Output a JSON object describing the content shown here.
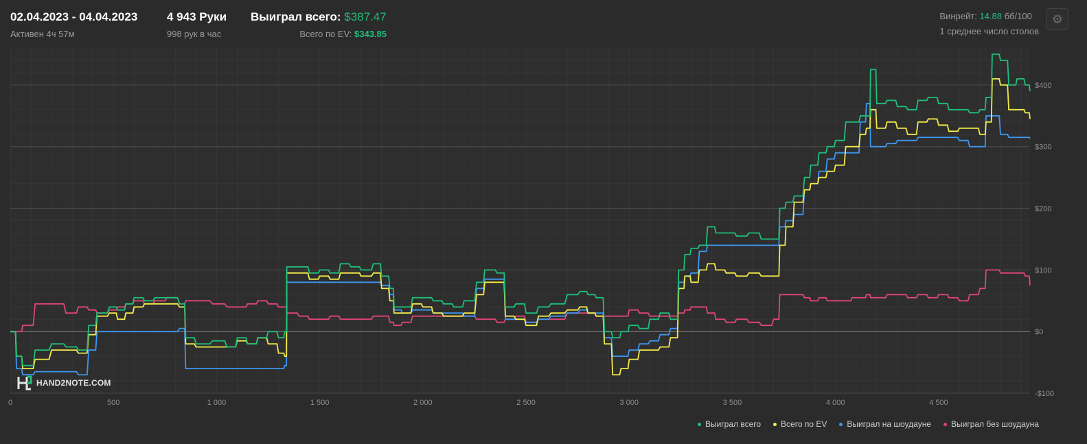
{
  "header": {
    "date_range": "02.04.2023 - 04.04.2023",
    "active": "Активен 4ч 57м",
    "hands": "4 943 Руки",
    "hands_per_hour": "998 рук в час",
    "won_label": "Выиграл всего:",
    "won_value": "$387.47",
    "ev_label": "Всего по EV:",
    "ev_value": "$343.85",
    "winrate_label": "Винрейт:",
    "winrate_value": "14.88",
    "winrate_unit": "бб/100",
    "avg_tables": "1 среднее число столов"
  },
  "logo": {
    "text": "HAND2NOTE.COM"
  },
  "colors": {
    "won_total": "#1fbf7a",
    "ev": "#f2ea4a",
    "showdown": "#3d97f0",
    "non_showdown": "#e0457a",
    "background": "#2b2b2b",
    "plot_bg": "#2e2e2e"
  },
  "chart_data": {
    "type": "line",
    "xlabel": "",
    "ylabel": "",
    "xlim": [
      0,
      4943
    ],
    "ylim": [
      -100,
      460
    ],
    "x_ticks": [
      0,
      500,
      1000,
      1500,
      2000,
      2500,
      3000,
      3500,
      4000,
      4500
    ],
    "x_tick_labels": [
      "0",
      "500",
      "1 000",
      "1 500",
      "2 000",
      "2 500",
      "3 000",
      "3 500",
      "4 000",
      "4 500"
    ],
    "y_ticks": [
      -100,
      0,
      100,
      200,
      300,
      400
    ],
    "y_tick_labels": [
      "-$100",
      "$0",
      "$100",
      "$200",
      "$300",
      "$400"
    ],
    "grid": true,
    "legend_position": "bottom-right",
    "series": [
      {
        "name": "Выиграл всего",
        "color": "#1fbf7a",
        "x": [
          0,
          30,
          60,
          120,
          200,
          270,
          330,
          380,
          420,
          480,
          520,
          560,
          600,
          650,
          700,
          760,
          820,
          850,
          900,
          980,
          1050,
          1100,
          1150,
          1200,
          1250,
          1300,
          1330,
          1340,
          1400,
          1450,
          1500,
          1550,
          1600,
          1650,
          1700,
          1760,
          1800,
          1840,
          1860,
          1900,
          1950,
          2000,
          2050,
          2100,
          2150,
          2200,
          2260,
          2300,
          2360,
          2400,
          2450,
          2500,
          2560,
          2620,
          2700,
          2760,
          2800,
          2840,
          2880,
          2920,
          2960,
          3000,
          3050,
          3100,
          3150,
          3200,
          3240,
          3270,
          3300,
          3340,
          3380,
          3420,
          3470,
          3520,
          3580,
          3640,
          3700,
          3730,
          3760,
          3800,
          3850,
          3880,
          3920,
          3960,
          4000,
          4050,
          4080,
          4120,
          4150,
          4170,
          4200,
          4250,
          4300,
          4350,
          4400,
          4450,
          4500,
          4550,
          4600,
          4650,
          4700,
          4730,
          4760,
          4800,
          4840,
          4880,
          4920,
          4943
        ],
        "y": [
          0,
          -40,
          -55,
          -30,
          -20,
          -25,
          -30,
          10,
          30,
          40,
          35,
          45,
          55,
          50,
          55,
          55,
          45,
          -10,
          -20,
          -15,
          -25,
          -10,
          -20,
          -10,
          0,
          -10,
          0,
          105,
          105,
          95,
          100,
          95,
          110,
          105,
          100,
          110,
          90,
          70,
          40,
          40,
          55,
          55,
          50,
          45,
          40,
          50,
          80,
          100,
          95,
          40,
          45,
          30,
          40,
          45,
          60,
          65,
          60,
          55,
          0,
          -10,
          0,
          10,
          5,
          20,
          30,
          20,
          100,
          125,
          135,
          140,
          170,
          160,
          160,
          155,
          160,
          150,
          150,
          200,
          210,
          220,
          250,
          270,
          290,
          300,
          310,
          340,
          340,
          350,
          350,
          425,
          370,
          375,
          365,
          360,
          375,
          380,
          370,
          360,
          360,
          355,
          360,
          380,
          450,
          440,
          400,
          410,
          400,
          390
        ]
      },
      {
        "name": "Всего по EV",
        "color": "#f2ea4a",
        "x": [
          0,
          30,
          60,
          120,
          200,
          270,
          330,
          380,
          420,
          480,
          520,
          560,
          600,
          650,
          700,
          760,
          820,
          850,
          900,
          980,
          1050,
          1100,
          1150,
          1200,
          1250,
          1300,
          1330,
          1340,
          1400,
          1450,
          1500,
          1550,
          1600,
          1650,
          1700,
          1760,
          1800,
          1840,
          1860,
          1900,
          1950,
          2000,
          2050,
          2100,
          2150,
          2200,
          2260,
          2300,
          2360,
          2400,
          2450,
          2500,
          2560,
          2620,
          2700,
          2760,
          2800,
          2840,
          2880,
          2920,
          2960,
          3000,
          3050,
          3100,
          3150,
          3200,
          3240,
          3270,
          3300,
          3340,
          3380,
          3420,
          3470,
          3520,
          3580,
          3640,
          3700,
          3730,
          3760,
          3800,
          3850,
          3880,
          3920,
          3960,
          4000,
          4050,
          4080,
          4120,
          4150,
          4170,
          4200,
          4250,
          4300,
          4350,
          4400,
          4450,
          4500,
          4550,
          4600,
          4650,
          4700,
          4730,
          4760,
          4800,
          4840,
          4880,
          4920,
          4943
        ],
        "y": [
          0,
          -40,
          -60,
          -45,
          -30,
          -30,
          -35,
          -5,
          25,
          30,
          20,
          30,
          40,
          45,
          45,
          45,
          40,
          -20,
          -25,
          -25,
          -25,
          -15,
          -20,
          -10,
          -20,
          -35,
          -40,
          95,
          95,
          85,
          90,
          85,
          95,
          95,
          90,
          95,
          70,
          50,
          30,
          30,
          45,
          40,
          30,
          25,
          25,
          30,
          60,
          80,
          80,
          25,
          20,
          10,
          25,
          30,
          35,
          40,
          30,
          25,
          -20,
          -70,
          -60,
          -45,
          -30,
          -30,
          -25,
          -10,
          70,
          90,
          80,
          100,
          110,
          100,
          95,
          90,
          95,
          90,
          90,
          140,
          170,
          210,
          230,
          240,
          250,
          260,
          270,
          300,
          300,
          320,
          330,
          360,
          330,
          340,
          330,
          320,
          340,
          345,
          335,
          325,
          330,
          330,
          320,
          340,
          410,
          400,
          360,
          360,
          355,
          345
        ]
      },
      {
        "name": "Выиграл на шоудауне",
        "color": "#3d97f0",
        "x": [
          0,
          30,
          60,
          120,
          200,
          270,
          330,
          380,
          420,
          480,
          520,
          560,
          600,
          650,
          700,
          760,
          820,
          850,
          900,
          980,
          1050,
          1100,
          1150,
          1200,
          1250,
          1300,
          1330,
          1340,
          1400,
          1450,
          1500,
          1550,
          1600,
          1650,
          1700,
          1760,
          1800,
          1840,
          1860,
          1900,
          1950,
          2000,
          2050,
          2100,
          2150,
          2200,
          2260,
          2300,
          2360,
          2400,
          2450,
          2500,
          2560,
          2620,
          2700,
          2760,
          2800,
          2840,
          2880,
          2920,
          2960,
          3000,
          3050,
          3100,
          3150,
          3200,
          3240,
          3270,
          3300,
          3340,
          3380,
          3420,
          3470,
          3520,
          3580,
          3640,
          3700,
          3730,
          3760,
          3800,
          3850,
          3880,
          3920,
          3960,
          4000,
          4050,
          4080,
          4120,
          4150,
          4170,
          4200,
          4250,
          4300,
          4350,
          4400,
          4450,
          4500,
          4550,
          4600,
          4650,
          4700,
          4730,
          4760,
          4800,
          4840,
          4880,
          4920,
          4943
        ],
        "y": [
          0,
          -60,
          -70,
          -65,
          -65,
          -65,
          -70,
          -30,
          0,
          0,
          0,
          0,
          0,
          0,
          0,
          0,
          5,
          -60,
          -60,
          -60,
          -60,
          -60,
          -60,
          -60,
          -60,
          -60,
          -55,
          80,
          80,
          80,
          80,
          80,
          80,
          80,
          80,
          80,
          75,
          60,
          35,
          30,
          35,
          35,
          30,
          30,
          30,
          25,
          70,
          85,
          85,
          20,
          20,
          15,
          20,
          25,
          30,
          35,
          30,
          30,
          -10,
          -40,
          -40,
          -30,
          -20,
          -15,
          -5,
          5,
          80,
          90,
          95,
          130,
          140,
          140,
          140,
          140,
          140,
          140,
          140,
          170,
          180,
          190,
          230,
          240,
          260,
          280,
          290,
          290,
          290,
          340,
          370,
          300,
          300,
          305,
          310,
          310,
          315,
          315,
          315,
          315,
          310,
          300,
          300,
          350,
          350,
          320,
          315,
          315,
          315,
          313
        ]
      },
      {
        "name": "Выиграл без шоудауна",
        "color": "#e0457a",
        "x": [
          0,
          30,
          60,
          120,
          200,
          270,
          330,
          380,
          420,
          480,
          520,
          560,
          600,
          650,
          700,
          760,
          820,
          850,
          900,
          980,
          1050,
          1100,
          1150,
          1200,
          1250,
          1300,
          1330,
          1340,
          1400,
          1450,
          1500,
          1550,
          1600,
          1650,
          1700,
          1760,
          1800,
          1840,
          1860,
          1900,
          1950,
          2000,
          2050,
          2100,
          2150,
          2200,
          2260,
          2300,
          2360,
          2400,
          2450,
          2500,
          2560,
          2620,
          2700,
          2760,
          2800,
          2840,
          2880,
          2920,
          2960,
          3000,
          3050,
          3100,
          3150,
          3200,
          3240,
          3270,
          3300,
          3340,
          3380,
          3420,
          3470,
          3520,
          3580,
          3640,
          3700,
          3730,
          3760,
          3800,
          3850,
          3880,
          3920,
          3960,
          4000,
          4050,
          4080,
          4120,
          4150,
          4170,
          4200,
          4250,
          4300,
          4350,
          4400,
          4450,
          4500,
          4550,
          4600,
          4650,
          4700,
          4730,
          4760,
          4800,
          4840,
          4880,
          4920,
          4943
        ],
        "y": [
          0,
          0,
          10,
          45,
          45,
          30,
          40,
          35,
          30,
          35,
          40,
          45,
          50,
          45,
          50,
          55,
          45,
          50,
          50,
          45,
          40,
          40,
          45,
          50,
          45,
          40,
          40,
          30,
          25,
          20,
          20,
          25,
          20,
          20,
          20,
          25,
          25,
          15,
          10,
          15,
          25,
          25,
          25,
          25,
          25,
          25,
          20,
          20,
          15,
          20,
          25,
          15,
          20,
          20,
          30,
          30,
          30,
          25,
          25,
          25,
          25,
          35,
          30,
          25,
          25,
          25,
          30,
          35,
          40,
          40,
          30,
          20,
          15,
          20,
          15,
          10,
          20,
          60,
          60,
          60,
          55,
          50,
          55,
          50,
          50,
          50,
          55,
          55,
          60,
          55,
          55,
          60,
          60,
          55,
          60,
          55,
          60,
          55,
          50,
          60,
          70,
          100,
          100,
          95,
          95,
          95,
          90,
          75
        ]
      }
    ]
  },
  "legend": [
    {
      "label": "Выиграл всего",
      "color": "#1fbf7a"
    },
    {
      "label": "Всего по EV",
      "color": "#f2ea4a"
    },
    {
      "label": "Выиграл на шоудауне",
      "color": "#3d97f0"
    },
    {
      "label": "Выиграл без шоудауна",
      "color": "#e0457a"
    }
  ]
}
